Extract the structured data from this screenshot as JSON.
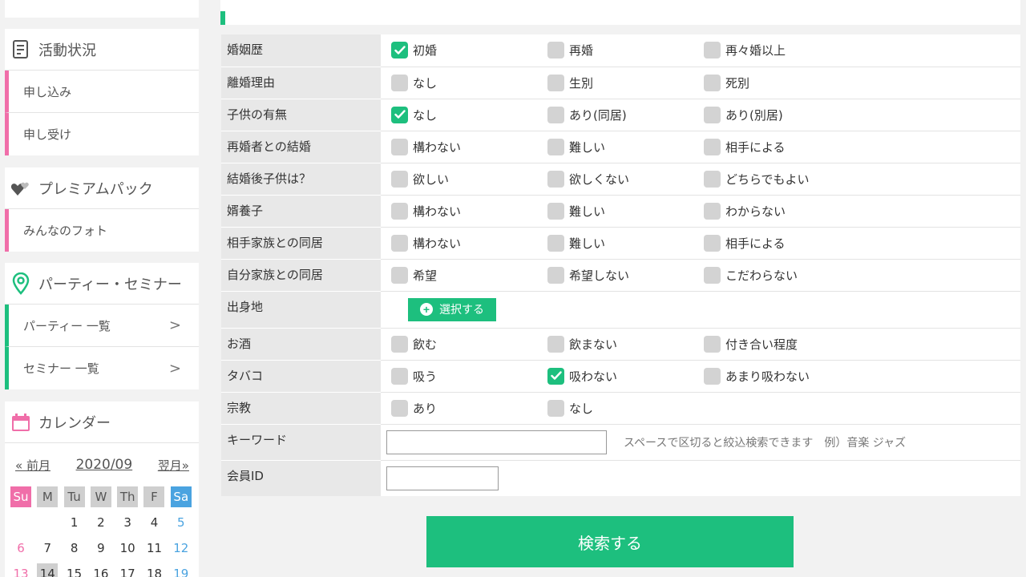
{
  "sidebar": {
    "activity": {
      "title": "活動状況",
      "icon": "document-icon",
      "items": [
        "申し込み",
        "申し受け"
      ]
    },
    "premium": {
      "title": "プレミアムパック",
      "icon": "hearts-icon",
      "items": [
        "みんなのフォト"
      ]
    },
    "party": {
      "title": "パーティー・セミナー",
      "icon": "map-pin-icon",
      "items": [
        "パーティー 一覧",
        "セミナー 一覧"
      ],
      "arrow": ">"
    },
    "calendar": {
      "title": "カレンダー",
      "icon": "calendar-icon",
      "prev": "« 前月",
      "month": "2020/09",
      "next": "翌月»",
      "dow": [
        "Su",
        "M",
        "Tu",
        "W",
        "Th",
        "F",
        "Sa"
      ],
      "week1": [
        "",
        "",
        "1",
        "2",
        "3",
        "4",
        "5"
      ],
      "week2": [
        "6",
        "7",
        "8",
        "9",
        "10",
        "11",
        "12"
      ],
      "week3": [
        "13",
        "14",
        "15",
        "16",
        "17",
        "18",
        "19"
      ]
    }
  },
  "form": {
    "rows": [
      {
        "label": "婚姻歴",
        "options": [
          {
            "text": "初婚",
            "checked": true
          },
          {
            "text": "再婚",
            "checked": false
          },
          {
            "text": "再々婚以上",
            "checked": false
          }
        ]
      },
      {
        "label": "離婚理由",
        "options": [
          {
            "text": "なし",
            "checked": false
          },
          {
            "text": "生別",
            "checked": false
          },
          {
            "text": "死別",
            "checked": false
          }
        ]
      },
      {
        "label": "子供の有無",
        "options": [
          {
            "text": "なし",
            "checked": true
          },
          {
            "text": "あり(同居)",
            "checked": false
          },
          {
            "text": "あり(別居)",
            "checked": false
          }
        ]
      },
      {
        "label": "再婚者との結婚",
        "options": [
          {
            "text": "構わない",
            "checked": false
          },
          {
            "text": "難しい",
            "checked": false
          },
          {
            "text": "相手による",
            "checked": false
          }
        ]
      },
      {
        "label": "結婚後子供は？",
        "options": [
          {
            "text": "欲しい",
            "checked": false
          },
          {
            "text": "欲しくない",
            "checked": false
          },
          {
            "text": "どちらでもよい",
            "checked": false
          }
        ]
      },
      {
        "label": "婿養子",
        "options": [
          {
            "text": "構わない",
            "checked": false
          },
          {
            "text": "難しい",
            "checked": false
          },
          {
            "text": "わからない",
            "checked": false
          }
        ]
      },
      {
        "label": "相手家族との同居",
        "options": [
          {
            "text": "構わない",
            "checked": false
          },
          {
            "text": "難しい",
            "checked": false
          },
          {
            "text": "相手による",
            "checked": false
          }
        ]
      },
      {
        "label": "自分家族との同居",
        "options": [
          {
            "text": "希望",
            "checked": false
          },
          {
            "text": "希望しない",
            "checked": false
          },
          {
            "text": "こだわらない",
            "checked": false
          }
        ]
      }
    ],
    "birthplace": {
      "label": "出身地",
      "button": "選択する"
    },
    "rows2": [
      {
        "label": "お酒",
        "options": [
          {
            "text": "飲む",
            "checked": false
          },
          {
            "text": "飲まない",
            "checked": false
          },
          {
            "text": "付き合い程度",
            "checked": false
          }
        ]
      },
      {
        "label": "タバコ",
        "options": [
          {
            "text": "吸う",
            "checked": false
          },
          {
            "text": "吸わない",
            "checked": true
          },
          {
            "text": "あまり吸わない",
            "checked": false
          }
        ]
      },
      {
        "label": "宗教",
        "options": [
          {
            "text": "あり",
            "checked": false
          },
          {
            "text": "なし",
            "checked": false
          }
        ]
      }
    ],
    "keyword": {
      "label": "キーワード",
      "value": "",
      "hint": "スペースで区切ると絞込検索できます　例）音楽 ジャズ"
    },
    "member_id": {
      "label": "会員ID",
      "value": ""
    },
    "submit": "検索する"
  },
  "colors": {
    "accent": "#1dbf7e",
    "pink": "#f06ea9",
    "blue": "#4aa3e0"
  }
}
